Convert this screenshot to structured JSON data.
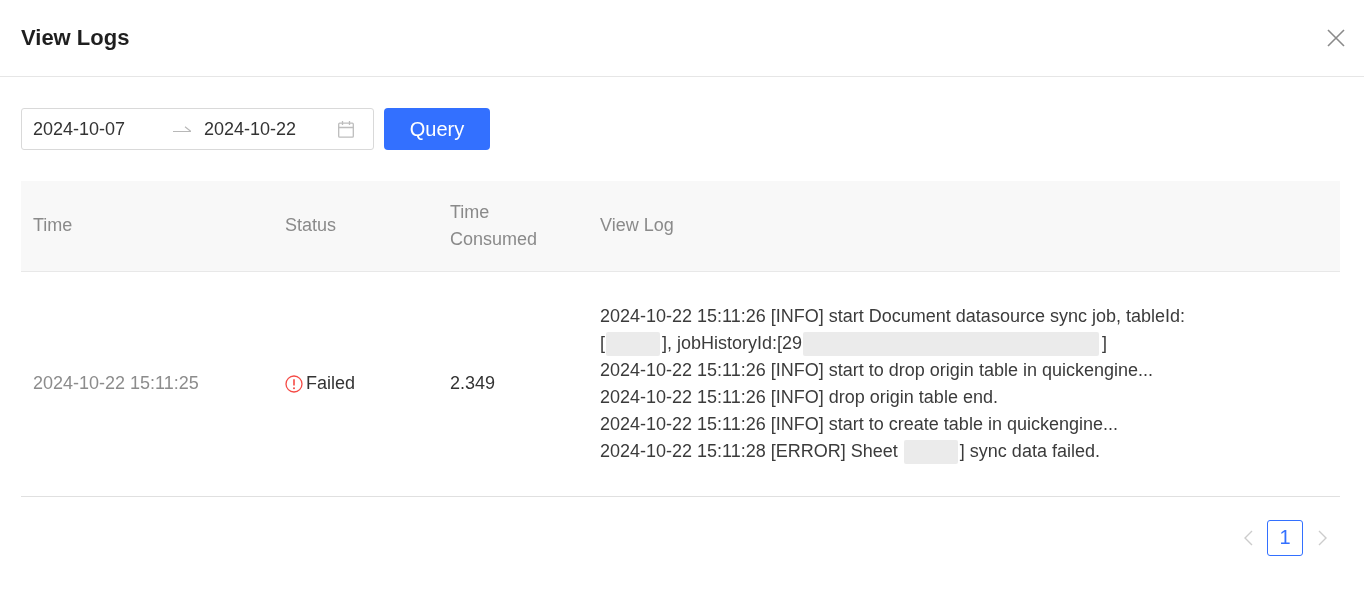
{
  "dialog": {
    "title": "View Logs"
  },
  "filter": {
    "start_date": "2024-10-07",
    "end_date": "2024-10-22",
    "query_button": "Query"
  },
  "table": {
    "columns": [
      "Time",
      "Status",
      "Time Consumed",
      "View Log"
    ],
    "rows": [
      {
        "time": "2024-10-22 15:11:25",
        "status": {
          "kind": "failed",
          "text": "Failed"
        },
        "time_consumed": "2.349",
        "log": [
          [
            {
              "kind": "text",
              "text": "2024-10-22 15:11:26 [INFO] start Document datasource sync job, tableId:"
            }
          ],
          [
            {
              "kind": "text",
              "text": "["
            },
            {
              "kind": "redaction"
            },
            {
              "kind": "text",
              "text": "], jobHistoryId:[29"
            },
            {
              "kind": "longredaction"
            },
            {
              "kind": "text",
              "text": "]"
            }
          ],
          [
            {
              "kind": "text",
              "text": "2024-10-22 15:11:26 [INFO] start to drop origin table in quickengine..."
            }
          ],
          [
            {
              "kind": "text",
              "text": "2024-10-22 15:11:26 [INFO] drop origin table end."
            }
          ],
          [
            {
              "kind": "text",
              "text": "2024-10-22 15:11:26 [INFO] start to create table in quickengine..."
            }
          ],
          [
            {
              "kind": "text",
              "text": "2024-10-22 15:11:28 [ERROR] Sheet "
            },
            {
              "kind": "redaction"
            },
            {
              "kind": "text",
              "text": "] sync data failed."
            }
          ]
        ]
      }
    ]
  },
  "pagination": {
    "prev_disabled": true,
    "pages": [
      {
        "label": "1",
        "selected": true
      }
    ],
    "next_disabled": true
  }
}
